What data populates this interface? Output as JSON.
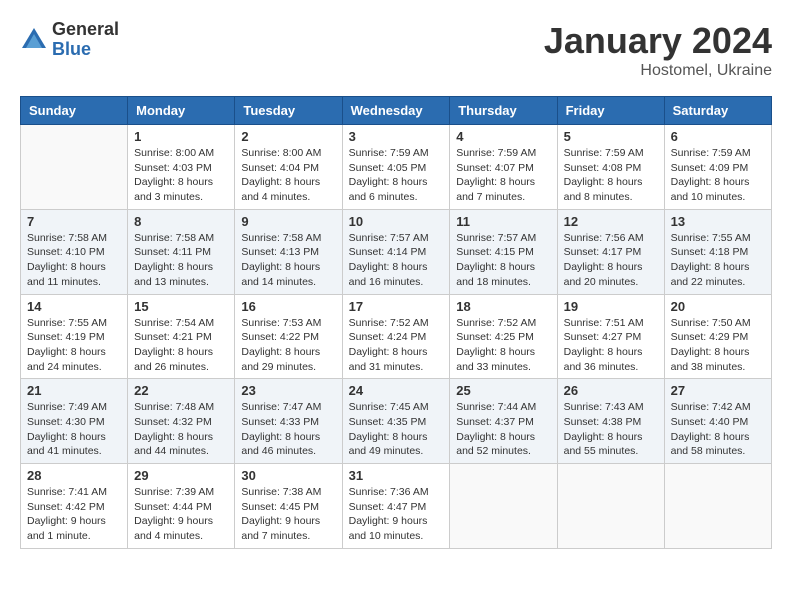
{
  "header": {
    "logo_general": "General",
    "logo_blue": "Blue",
    "month_title": "January 2024",
    "location": "Hostomel, Ukraine"
  },
  "days_of_week": [
    "Sunday",
    "Monday",
    "Tuesday",
    "Wednesday",
    "Thursday",
    "Friday",
    "Saturday"
  ],
  "weeks": [
    [
      {
        "day": "",
        "info": ""
      },
      {
        "day": "1",
        "info": "Sunrise: 8:00 AM\nSunset: 4:03 PM\nDaylight: 8 hours\nand 3 minutes."
      },
      {
        "day": "2",
        "info": "Sunrise: 8:00 AM\nSunset: 4:04 PM\nDaylight: 8 hours\nand 4 minutes."
      },
      {
        "day": "3",
        "info": "Sunrise: 7:59 AM\nSunset: 4:05 PM\nDaylight: 8 hours\nand 6 minutes."
      },
      {
        "day": "4",
        "info": "Sunrise: 7:59 AM\nSunset: 4:07 PM\nDaylight: 8 hours\nand 7 minutes."
      },
      {
        "day": "5",
        "info": "Sunrise: 7:59 AM\nSunset: 4:08 PM\nDaylight: 8 hours\nand 8 minutes."
      },
      {
        "day": "6",
        "info": "Sunrise: 7:59 AM\nSunset: 4:09 PM\nDaylight: 8 hours\nand 10 minutes."
      }
    ],
    [
      {
        "day": "7",
        "info": "Sunrise: 7:58 AM\nSunset: 4:10 PM\nDaylight: 8 hours\nand 11 minutes."
      },
      {
        "day": "8",
        "info": "Sunrise: 7:58 AM\nSunset: 4:11 PM\nDaylight: 8 hours\nand 13 minutes."
      },
      {
        "day": "9",
        "info": "Sunrise: 7:58 AM\nSunset: 4:13 PM\nDaylight: 8 hours\nand 14 minutes."
      },
      {
        "day": "10",
        "info": "Sunrise: 7:57 AM\nSunset: 4:14 PM\nDaylight: 8 hours\nand 16 minutes."
      },
      {
        "day": "11",
        "info": "Sunrise: 7:57 AM\nSunset: 4:15 PM\nDaylight: 8 hours\nand 18 minutes."
      },
      {
        "day": "12",
        "info": "Sunrise: 7:56 AM\nSunset: 4:17 PM\nDaylight: 8 hours\nand 20 minutes."
      },
      {
        "day": "13",
        "info": "Sunrise: 7:55 AM\nSunset: 4:18 PM\nDaylight: 8 hours\nand 22 minutes."
      }
    ],
    [
      {
        "day": "14",
        "info": "Sunrise: 7:55 AM\nSunset: 4:19 PM\nDaylight: 8 hours\nand 24 minutes."
      },
      {
        "day": "15",
        "info": "Sunrise: 7:54 AM\nSunset: 4:21 PM\nDaylight: 8 hours\nand 26 minutes."
      },
      {
        "day": "16",
        "info": "Sunrise: 7:53 AM\nSunset: 4:22 PM\nDaylight: 8 hours\nand 29 minutes."
      },
      {
        "day": "17",
        "info": "Sunrise: 7:52 AM\nSunset: 4:24 PM\nDaylight: 8 hours\nand 31 minutes."
      },
      {
        "day": "18",
        "info": "Sunrise: 7:52 AM\nSunset: 4:25 PM\nDaylight: 8 hours\nand 33 minutes."
      },
      {
        "day": "19",
        "info": "Sunrise: 7:51 AM\nSunset: 4:27 PM\nDaylight: 8 hours\nand 36 minutes."
      },
      {
        "day": "20",
        "info": "Sunrise: 7:50 AM\nSunset: 4:29 PM\nDaylight: 8 hours\nand 38 minutes."
      }
    ],
    [
      {
        "day": "21",
        "info": "Sunrise: 7:49 AM\nSunset: 4:30 PM\nDaylight: 8 hours\nand 41 minutes."
      },
      {
        "day": "22",
        "info": "Sunrise: 7:48 AM\nSunset: 4:32 PM\nDaylight: 8 hours\nand 44 minutes."
      },
      {
        "day": "23",
        "info": "Sunrise: 7:47 AM\nSunset: 4:33 PM\nDaylight: 8 hours\nand 46 minutes."
      },
      {
        "day": "24",
        "info": "Sunrise: 7:45 AM\nSunset: 4:35 PM\nDaylight: 8 hours\nand 49 minutes."
      },
      {
        "day": "25",
        "info": "Sunrise: 7:44 AM\nSunset: 4:37 PM\nDaylight: 8 hours\nand 52 minutes."
      },
      {
        "day": "26",
        "info": "Sunrise: 7:43 AM\nSunset: 4:38 PM\nDaylight: 8 hours\nand 55 minutes."
      },
      {
        "day": "27",
        "info": "Sunrise: 7:42 AM\nSunset: 4:40 PM\nDaylight: 8 hours\nand 58 minutes."
      }
    ],
    [
      {
        "day": "28",
        "info": "Sunrise: 7:41 AM\nSunset: 4:42 PM\nDaylight: 9 hours\nand 1 minute."
      },
      {
        "day": "29",
        "info": "Sunrise: 7:39 AM\nSunset: 4:44 PM\nDaylight: 9 hours\nand 4 minutes."
      },
      {
        "day": "30",
        "info": "Sunrise: 7:38 AM\nSunset: 4:45 PM\nDaylight: 9 hours\nand 7 minutes."
      },
      {
        "day": "31",
        "info": "Sunrise: 7:36 AM\nSunset: 4:47 PM\nDaylight: 9 hours\nand 10 minutes."
      },
      {
        "day": "",
        "info": ""
      },
      {
        "day": "",
        "info": ""
      },
      {
        "day": "",
        "info": ""
      }
    ]
  ]
}
